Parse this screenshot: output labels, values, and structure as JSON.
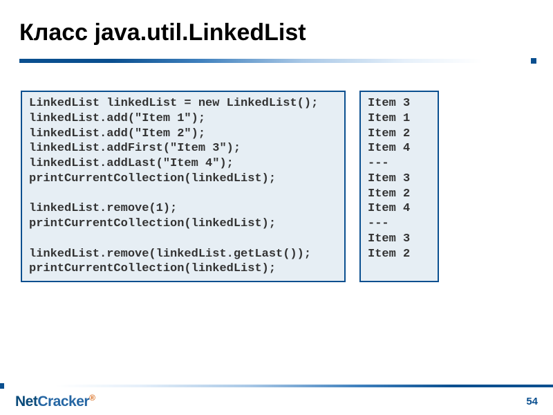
{
  "title": "Класс java.util.LinkedList",
  "code": "LinkedList linkedList = new LinkedList();\nlinkedList.add(\"Item 1\");\nlinkedList.add(\"Item 2\");\nlinkedList.addFirst(\"Item 3\");\nlinkedList.addLast(\"Item 4\");\nprintCurrentCollection(linkedList);\n\nlinkedList.remove(1);\nprintCurrentCollection(linkedList);\n\nlinkedList.remove(linkedList.getLast());\nprintCurrentCollection(linkedList);",
  "output": "Item 3\nItem 1\nItem 2\nItem 4\n---\nItem 3\nItem 2\nItem 4\n---\nItem 3\nItem 2",
  "logo": {
    "part1": "Net",
    "part2": "Cracker",
    "reg": "®"
  },
  "page": "54"
}
